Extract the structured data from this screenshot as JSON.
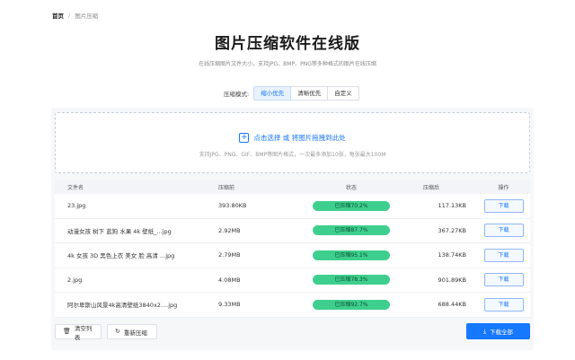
{
  "breadcrumb": {
    "home": "首页",
    "separator": "/",
    "current": "图片压缩"
  },
  "page": {
    "title": "图片压缩软件在线版",
    "subtitle": "在线压缩图片文件大小，支持JPG、BMP、PNG等多种格式的图片在线压缩"
  },
  "mode": {
    "label": "压缩模式:",
    "options": [
      "缩小优先",
      "清晰优先",
      "自定义"
    ],
    "selected": "缩小优先"
  },
  "upload": {
    "action_text": "点击选择 或 将图片拖拽到此处",
    "hint": "支持JPG、PNG、GIF、BMP等图片格式，一次最多添加10张，每张最大100M"
  },
  "table": {
    "headers": {
      "name": "文件名",
      "before": "压缩前",
      "status": "状态",
      "after": "压缩后",
      "op": "操作"
    },
    "rows": [
      {
        "name": "23.jpg",
        "before": "393.80KB",
        "status": "已压缩70.2%",
        "after": "117.13KB",
        "op": "下载"
      },
      {
        "name": "动漫女孩 树下 蓝狗 水果 4k 壁纸_...jpg",
        "before": "2.92MB",
        "status": "已压缩87.7%",
        "after": "367.27KB",
        "op": "下载"
      },
      {
        "name": "4k 女孩 3D 黑色上衣 美女 脸 高清 ...jpg",
        "before": "2.79MB",
        "status": "已压缩95.1%",
        "after": "138.74KB",
        "op": "下载"
      },
      {
        "name": "2.jpg",
        "before": "4.08MB",
        "status": "已压缩78.3%",
        "after": "901.89KB",
        "op": "下载"
      },
      {
        "name": "阿尔卑斯山风景4k高清壁纸3840x2....jpg",
        "before": "9.33MB",
        "status": "已压缩92.7%",
        "after": "688.44KB",
        "op": "下载"
      }
    ]
  },
  "actions": {
    "clear": "清空列表",
    "recompress": "重新压缩",
    "download_all": "下载全部"
  },
  "colors": {
    "accent": "#1677ff",
    "status_green": "#3ecf8e"
  }
}
